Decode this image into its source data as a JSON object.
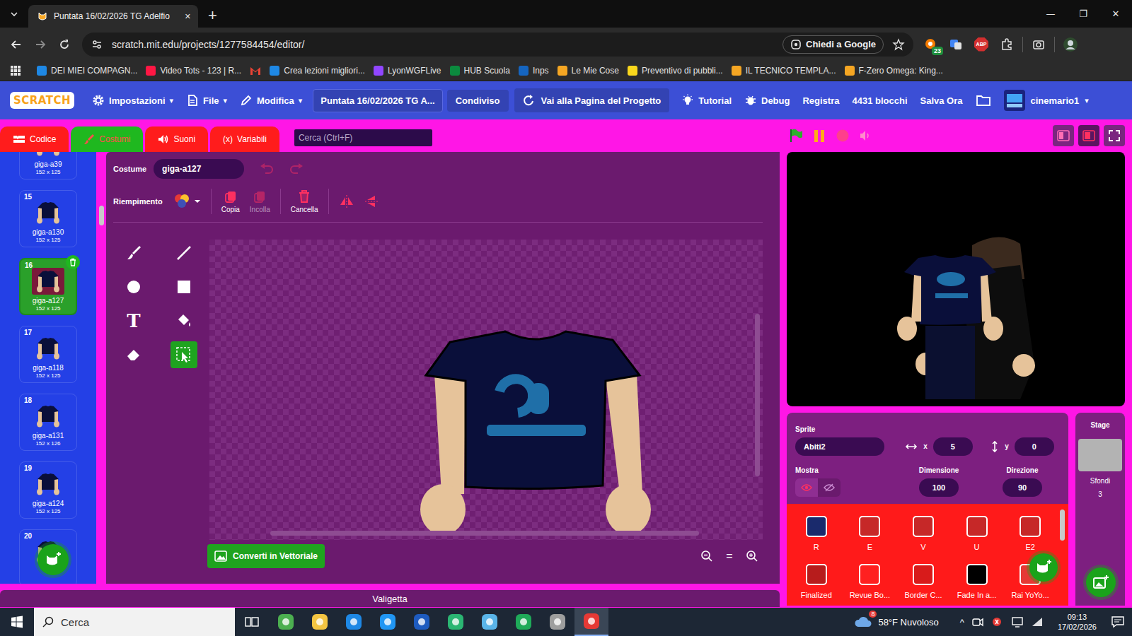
{
  "browser": {
    "tabs": [
      {
        "title": "Puntata 16/02/2026 TG Adelfio",
        "selected": true
      }
    ],
    "tab_close": "✕",
    "new_tab": "+",
    "window_controls": [
      "—",
      "❐",
      "✕"
    ],
    "url": "scratch.mit.edu/projects/1277584454/editor/",
    "ask_google": "Chiedi a Google",
    "extension_badge": "23",
    "abp": "ABP",
    "bookmarks": [
      {
        "label": "DEI MIEI COMPAGN...",
        "kind": "link",
        "color": "#1e88e5"
      },
      {
        "label": "Video Tots - 123 | R...",
        "kind": "link",
        "color": "#ff1744"
      },
      {
        "kind": "icon",
        "color": "#ea4335"
      },
      {
        "label": "Crea lezioni migliori...",
        "kind": "link",
        "color": "#1e88e5"
      },
      {
        "label": "LyonWGFLive",
        "kind": "link",
        "color": "#9146ff"
      },
      {
        "label": "HUB Scuola",
        "kind": "link",
        "color": "#0b8a3e"
      },
      {
        "label": "Inps",
        "kind": "link",
        "color": "#1565c0"
      },
      {
        "label": "Le Mie Cose",
        "kind": "link",
        "color": "#f5a623"
      },
      {
        "label": "Preventivo di pubbli...",
        "kind": "link",
        "color": "#f9d71c"
      },
      {
        "label": "IL TECNICO TEMPLA...",
        "kind": "link",
        "color": "#f5a623"
      },
      {
        "label": "F-Zero Omega: King...",
        "kind": "link",
        "color": "#f5a623"
      }
    ]
  },
  "scratch": {
    "logo": "SCRATCH",
    "menus": [
      {
        "label": "Impostazioni",
        "kind": "gear"
      },
      {
        "label": "File",
        "kind": "file"
      },
      {
        "label": "Modifica",
        "kind": "pencil"
      }
    ],
    "caret": "▾",
    "project_title": "Puntata 16/02/2026 TG A...",
    "share": "Condiviso",
    "project_page": "Vai alla Pagina del Progetto",
    "tutorial": "Tutorial",
    "debug": "Debug",
    "record": "Registra",
    "block_count": "4431 blocchi",
    "save": "Salva Ora",
    "username": "cinemario1"
  },
  "editor_tabs": [
    {
      "label": "Codice",
      "kind": "code",
      "selected": false
    },
    {
      "label": "Costumi",
      "kind": "costumes",
      "selected": true
    },
    {
      "label": "Suoni",
      "kind": "sounds",
      "selected": false
    },
    {
      "label": "Variabili",
      "kind": "variables",
      "glyph": "(x)",
      "selected": false
    }
  ],
  "search": {
    "placeholder": "Cerca (Ctrl+F)"
  },
  "stage_modes": [
    {
      "kind": "small",
      "selected": false
    },
    {
      "kind": "large",
      "selected": true
    },
    {
      "kind": "full",
      "selected": false
    }
  ],
  "costumes": [
    {
      "number": "",
      "name": "giga-a39",
      "size": "152 x 125",
      "selected": false
    },
    {
      "number": "15",
      "name": "giga-a130",
      "size": "152 x 125",
      "selected": false
    },
    {
      "number": "16",
      "name": "giga-a127",
      "size": "152 x 125",
      "selected": true
    },
    {
      "number": "17",
      "name": "giga-a118",
      "size": "152 x 125",
      "selected": false
    },
    {
      "number": "18",
      "name": "giga-a131",
      "size": "152 x 126",
      "selected": false
    },
    {
      "number": "19",
      "name": "giga-a124",
      "size": "152 x 125",
      "selected": false
    },
    {
      "number": "20",
      "name": "",
      "size": "",
      "selected": false
    }
  ],
  "paint": {
    "costume_label": "Costume",
    "costume_name": "giga-a127",
    "undo_disabled": true,
    "redo_disabled": true,
    "fill_label": "Riempimento",
    "actions": [
      {
        "label": "Copia",
        "kind": "copy",
        "disabled": false
      },
      {
        "label": "Incolla",
        "kind": "paste",
        "disabled": true
      },
      {
        "label": "Cancella",
        "kind": "delete",
        "disabled": false
      }
    ],
    "tools": [
      {
        "kind": "brush",
        "selected": false
      },
      {
        "kind": "line",
        "selected": false
      },
      {
        "kind": "circle",
        "selected": false
      },
      {
        "kind": "rect",
        "selected": false
      },
      {
        "kind": "text",
        "glyph": "T",
        "selected": false
      },
      {
        "kind": "fill",
        "selected": false
      },
      {
        "kind": "eraser",
        "selected": false
      },
      {
        "kind": "select",
        "selected": true
      }
    ],
    "convert_button": "Converti in Vettoriale",
    "zoom_reset": "="
  },
  "sprite": {
    "label": "Sprite",
    "name": "Abiti2",
    "x_label": "x",
    "x": "5",
    "y_label": "y",
    "y": "0",
    "show_label": "Mostra",
    "visible": true,
    "size_label": "Dimensione",
    "size": "100",
    "direction_label": "Direzione",
    "direction": "90"
  },
  "sprites": [
    {
      "name": "R",
      "color": "#1a2a6c",
      "selected": false
    },
    {
      "name": "E",
      "color": "#c62828",
      "selected": false
    },
    {
      "name": "V",
      "color": "#c62828",
      "selected": false
    },
    {
      "name": "U",
      "color": "#c62828",
      "selected": false
    },
    {
      "name": "E2",
      "color": "#c62828",
      "selected": false
    },
    {
      "name": "Finalized",
      "color": "#b71c1c",
      "selected": false
    },
    {
      "name": "Revue Bo...",
      "color": "#ff2020",
      "selected": false
    },
    {
      "name": "Border C...",
      "color": "#d81b1b",
      "selected": false
    },
    {
      "name": "Fade In a...",
      "color": "#000000",
      "selected": false
    },
    {
      "name": "Rai YoYo...",
      "color": "#e53935",
      "selected": false
    }
  ],
  "stage_pane": {
    "title": "Stage",
    "backdrops_label": "Sfondi",
    "backdrop_count": "3"
  },
  "backpack": "Valigetta",
  "taskbar": {
    "search": "Cerca",
    "apps": [
      {
        "color": "#4caf50",
        "active": false
      },
      {
        "color": "#f4c542",
        "active": false
      },
      {
        "color": "#1e88e5",
        "active": false
      },
      {
        "color": "#2196f3",
        "active": false
      },
      {
        "color": "#1e5bbf",
        "active": false
      },
      {
        "color": "#2bb673",
        "active": false
      },
      {
        "color": "#5ab4e8",
        "active": false
      },
      {
        "color": "#1faa59",
        "active": false
      },
      {
        "color": "#9e9e9e",
        "active": false
      },
      {
        "color": "#e53935",
        "active": true
      }
    ],
    "weather_badge": "8",
    "weather": "58°F Nuvoloso",
    "tray_arrow": "^",
    "time": "09:13",
    "date": "17/02/2026"
  }
}
